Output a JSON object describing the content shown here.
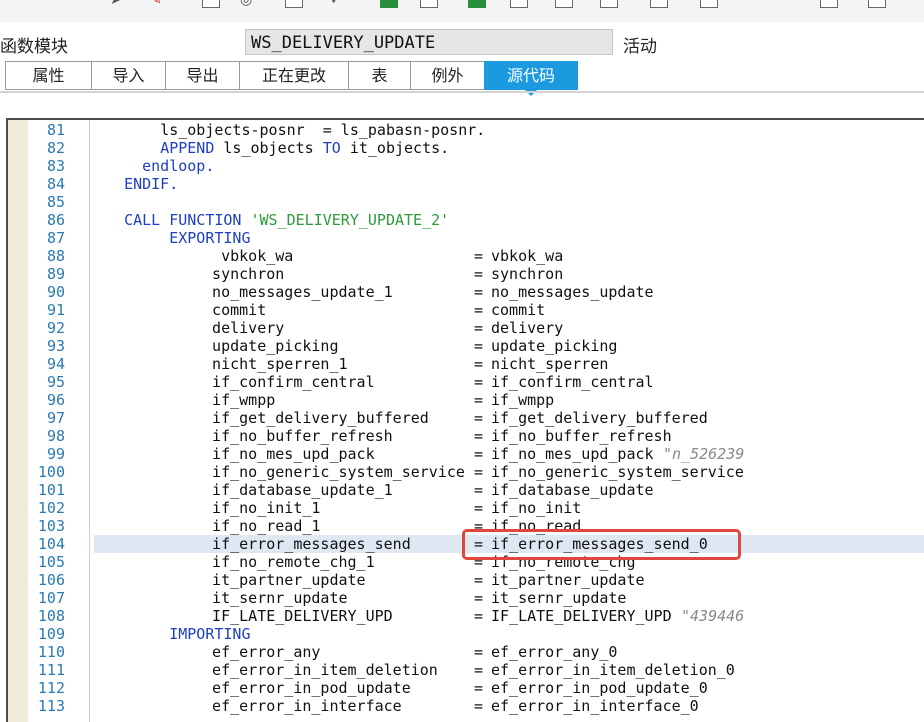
{
  "header": {
    "module_label": "函数模块",
    "module_name": "WS_DELIVERY_UPDATE",
    "status": "活动"
  },
  "tabs": [
    {
      "label": "属性"
    },
    {
      "label": "导入"
    },
    {
      "label": "导出"
    },
    {
      "label": "正在更改"
    },
    {
      "label": "表"
    },
    {
      "label": "例外"
    },
    {
      "label": "源代码",
      "active": true
    }
  ],
  "editor": {
    "highlighted_line": "104",
    "lines": [
      {
        "num": "81",
        "indent": "      ",
        "a": "ls_objects-posnr  = ls_pabasn-posnr.",
        "b": "",
        "k": ""
      },
      {
        "num": "82",
        "indent": "      ",
        "k": "APPEND",
        "a": " ls_objects ",
        "k2": "TO",
        "a2": " it_objects."
      },
      {
        "num": "83",
        "indent": "    ",
        "k": "endloop.",
        "a": ""
      },
      {
        "num": "84",
        "indent": "  ",
        "k": "ENDIF.",
        "a": ""
      },
      {
        "num": "85",
        "indent": "",
        "a": ""
      },
      {
        "num": "86",
        "indent": "  ",
        "k": "CALL FUNCTION ",
        "s": "'WS_DELIVERY_UPDATE_2'",
        "a": ""
      },
      {
        "num": "87",
        "indent": "       ",
        "k": "EXPORTING",
        "a": ""
      },
      {
        "num": "88",
        "p": "   vbkok_wa",
        "v": "vbkok_wa"
      },
      {
        "num": "89",
        "p": "  synchron",
        "v": "synchron"
      },
      {
        "num": "90",
        "p": "  no_messages_update_1",
        "v": "no_messages_update"
      },
      {
        "num": "91",
        "p": "  commit",
        "v": "commit"
      },
      {
        "num": "92",
        "p": "  delivery",
        "v": "delivery"
      },
      {
        "num": "93",
        "p": "  update_picking",
        "v": "update_picking"
      },
      {
        "num": "94",
        "p": "  nicht_sperren_1",
        "v": "nicht_sperren"
      },
      {
        "num": "95",
        "p": "  if_confirm_central",
        "v": "if_confirm_central"
      },
      {
        "num": "96",
        "p": "  if_wmpp",
        "v": "if_wmpp"
      },
      {
        "num": "97",
        "p": "  if_get_delivery_buffered",
        "v": "if_get_delivery_buffered"
      },
      {
        "num": "98",
        "p": "  if_no_buffer_refresh",
        "v": "if_no_buffer_refresh"
      },
      {
        "num": "99",
        "p": "  if_no_mes_upd_pack",
        "v": "if_no_mes_upd_pack",
        "c": "\"n_526239"
      },
      {
        "num": "100",
        "p": "  if_no_generic_system_service",
        "v": "if_no_generic_system_service"
      },
      {
        "num": "101",
        "p": "  if_database_update_1",
        "v": "if_database_update"
      },
      {
        "num": "102",
        "p": "  if_no_init_1",
        "v": "if_no_init"
      },
      {
        "num": "103",
        "p": "  if_no_read_1",
        "v": "if_no_read"
      },
      {
        "num": "104",
        "p": "  if_error_messages_send",
        "v": "if_error_messages_send_0"
      },
      {
        "num": "105",
        "p": "  if_no_remote_chg_1",
        "v": "if_no_remote_chg"
      },
      {
        "num": "106",
        "p": "  it_partner_update",
        "v": "it_partner_update"
      },
      {
        "num": "107",
        "p": "  it_sernr_update",
        "v": "it_sernr_update"
      },
      {
        "num": "108",
        "p": "  IF_LATE_DELIVERY_UPD",
        "v": "IF_LATE_DELIVERY_UPD",
        "c": "\"439446"
      },
      {
        "num": "109",
        "indent": "       ",
        "k": "IMPORTING",
        "a": ""
      },
      {
        "num": "110",
        "p": "  ef_error_any",
        "v": "ef_error_any_0"
      },
      {
        "num": "111",
        "p": "  ef_error_in_item_deletion",
        "v": "ef_error_in_item_deletion_0"
      },
      {
        "num": "112",
        "p": "  ef_error_in_pod_update",
        "v": "ef_error_in_pod_update_0"
      },
      {
        "num": "113",
        "p": "  ef_error_in_interface",
        "v": "ef_error_in_interface_0"
      }
    ]
  },
  "colors": {
    "tab_active": "#1b9ae0",
    "keyword": "#1e3fbf",
    "string": "#2e9a3a",
    "line_number": "#2a7ab0",
    "highlight_box": "#e0463c"
  }
}
